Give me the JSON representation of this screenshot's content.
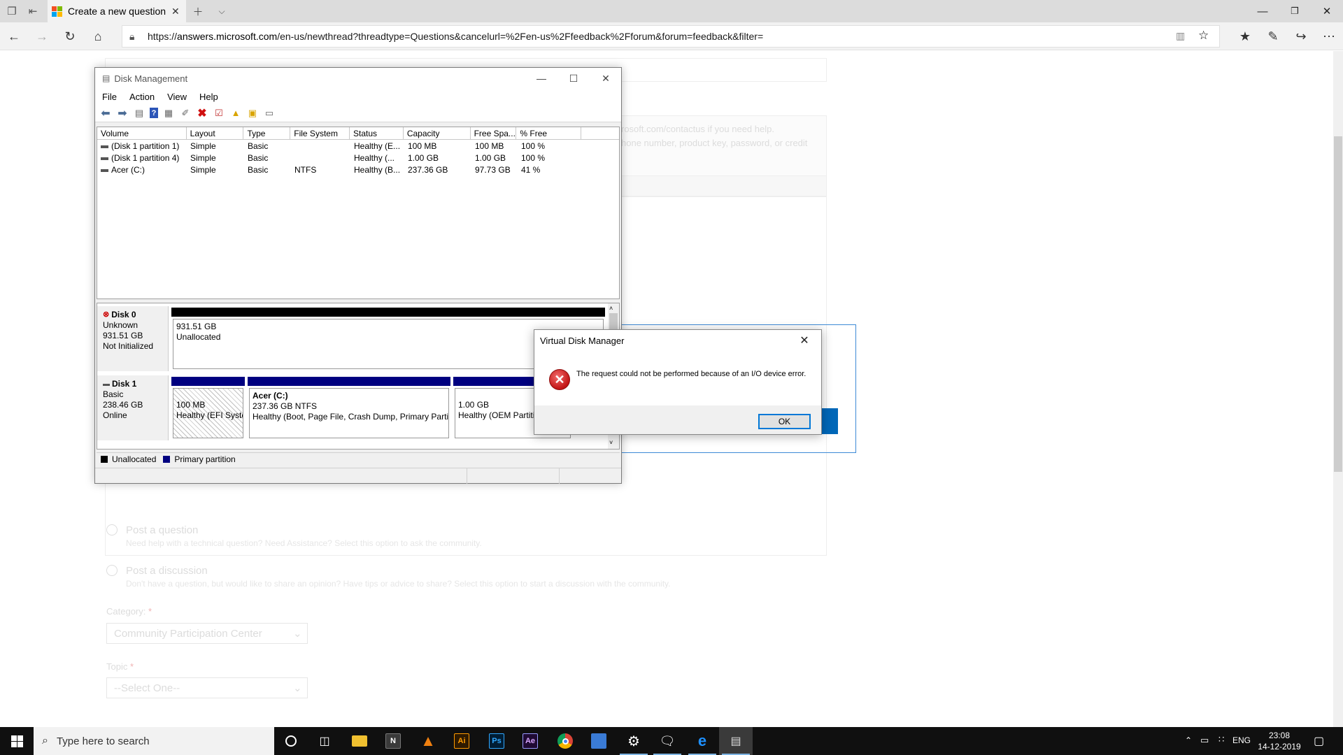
{
  "browser": {
    "tab_title": "Create a new question c",
    "url_prefix": "https://",
    "url_host": "answers.microsoft.com",
    "url_path": "/en-us/newthread?threadtype=Questions&cancelurl=%2Fen-us%2Ffeedback%2Fforum&forum=feedback&filter="
  },
  "page": {
    "contact_line1": "rosoft.com/contactus if you need help.",
    "contact_line2": "hone number, product key, password, or credit",
    "opt_question_title": "Post a question",
    "opt_question_desc": "Need help with a technical question? Need Assistance? Select this option to ask the community.",
    "opt_discussion_title": "Post a discussion",
    "opt_discussion_desc": "Don't have a question, but would like to share an opinion? Have tips or advice to share? Select this option to start a discussion with the community.",
    "category_label": "Category:",
    "category_value": "Community Participation Center",
    "topic_label": "Topic",
    "topic_value": "--Select One--"
  },
  "disk_management": {
    "title": "Disk Management",
    "menu": [
      "File",
      "Action",
      "View",
      "Help"
    ],
    "columns": [
      "Volume",
      "Layout",
      "Type",
      "File System",
      "Status",
      "Capacity",
      "Free Spa...",
      "% Free",
      ""
    ],
    "volumes": [
      {
        "volume": "(Disk 1 partition 1)",
        "layout": "Simple",
        "type": "Basic",
        "fs": "",
        "status": "Healthy (E...",
        "capacity": "100 MB",
        "free": "100 MB",
        "pct": "100 %"
      },
      {
        "volume": "(Disk 1 partition 4)",
        "layout": "Simple",
        "type": "Basic",
        "fs": "",
        "status": "Healthy (...",
        "capacity": "1.00 GB",
        "free": "1.00 GB",
        "pct": "100 %"
      },
      {
        "volume": "Acer (C:)",
        "layout": "Simple",
        "type": "Basic",
        "fs": "NTFS",
        "status": "Healthy (B...",
        "capacity": "237.36 GB",
        "free": "97.73 GB",
        "pct": "41 %"
      }
    ],
    "disk0": {
      "name": "Disk 0",
      "kind": "Unknown",
      "size": "931.51 GB",
      "state": "Not Initialized",
      "part_size": "931.51 GB",
      "part_label": "Unallocated"
    },
    "disk1": {
      "name": "Disk 1",
      "kind": "Basic",
      "size": "238.46 GB",
      "state": "Online",
      "p1_size": "100 MB",
      "p1_status": "Healthy (EFI Syste",
      "p2_name": "Acer  (C:)",
      "p2_size": "237.36 GB NTFS",
      "p2_status": "Healthy (Boot, Page File, Crash Dump, Primary Partit",
      "p3_size": "1.00 GB",
      "p3_status": "Healthy (OEM Partitio"
    },
    "legend_unallocated": "Unallocated",
    "legend_primary": "Primary partition",
    "colors": {
      "unallocated": "#000000",
      "primary": "#000080"
    }
  },
  "dialog": {
    "title": "Virtual Disk Manager",
    "message": "The request could not be performed because of an I/O device error.",
    "ok_label": "OK"
  },
  "taskbar": {
    "search_placeholder": "Type here to search",
    "apps": [
      "cortana-icon",
      "task-view-icon",
      "file-explorer-icon",
      "notepad-icon",
      "vlc-icon",
      "illustrator-icon",
      "photoshop-icon",
      "after-effects-icon",
      "chrome-icon",
      "photos-icon",
      "settings-icon",
      "feedback-hub-icon",
      "edge-icon",
      "disk-management-icon"
    ],
    "ai_label": "Ai",
    "ps_label": "Ps",
    "ae_label": "Ae",
    "lang": "ENG",
    "time": "23:08",
    "date": "14-12-2019"
  }
}
